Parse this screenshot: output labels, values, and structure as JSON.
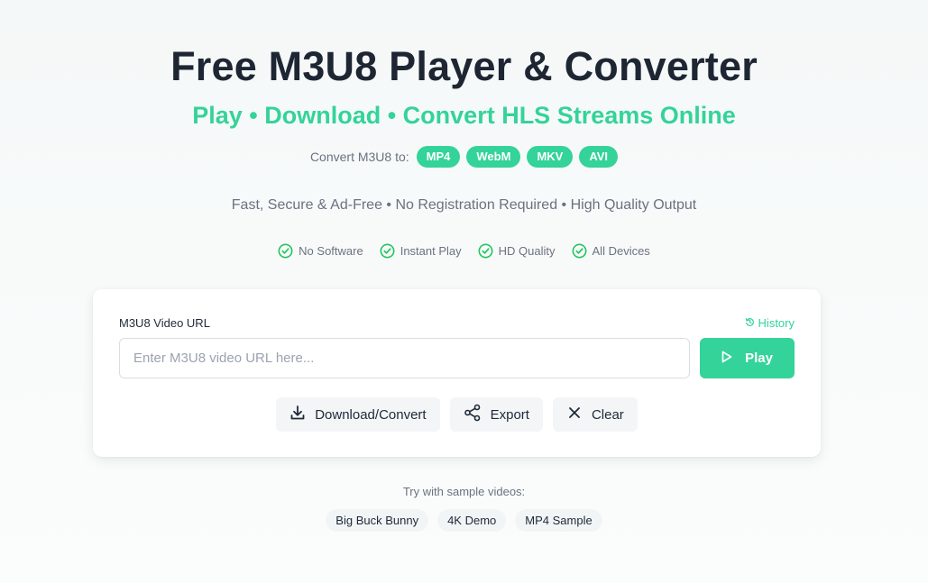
{
  "header": {
    "title": "Free M3U8 Player & Converter",
    "subtitle": "Play • Download • Convert HLS Streams Online",
    "formats_label": "Convert M3U8 to:",
    "formats": [
      "MP4",
      "WebM",
      "MKV",
      "AVI"
    ],
    "tagline": "Fast, Secure & Ad-Free • No Registration Required • High Quality Output",
    "features": [
      "No Software",
      "Instant Play",
      "HD Quality",
      "All Devices"
    ]
  },
  "player": {
    "url_label": "M3U8 Video URL",
    "history_label": "History",
    "url_value": "",
    "url_placeholder": "Enter M3U8 video URL here...",
    "play_label": "Play",
    "download_label": "Download/Convert",
    "export_label": "Export",
    "clear_label": "Clear"
  },
  "samples": {
    "label": "Try with sample videos:",
    "items": [
      "Big Buck Bunny",
      "4K Demo",
      "MP4 Sample"
    ]
  },
  "colors": {
    "accent": "#34d399",
    "title": "#1e2633",
    "muted": "#6b7280"
  },
  "icons": {
    "feature": "check-circle-icon",
    "history": "history-icon",
    "play": "play-icon",
    "download": "download-icon",
    "export": "share-icon",
    "clear": "close-icon"
  }
}
